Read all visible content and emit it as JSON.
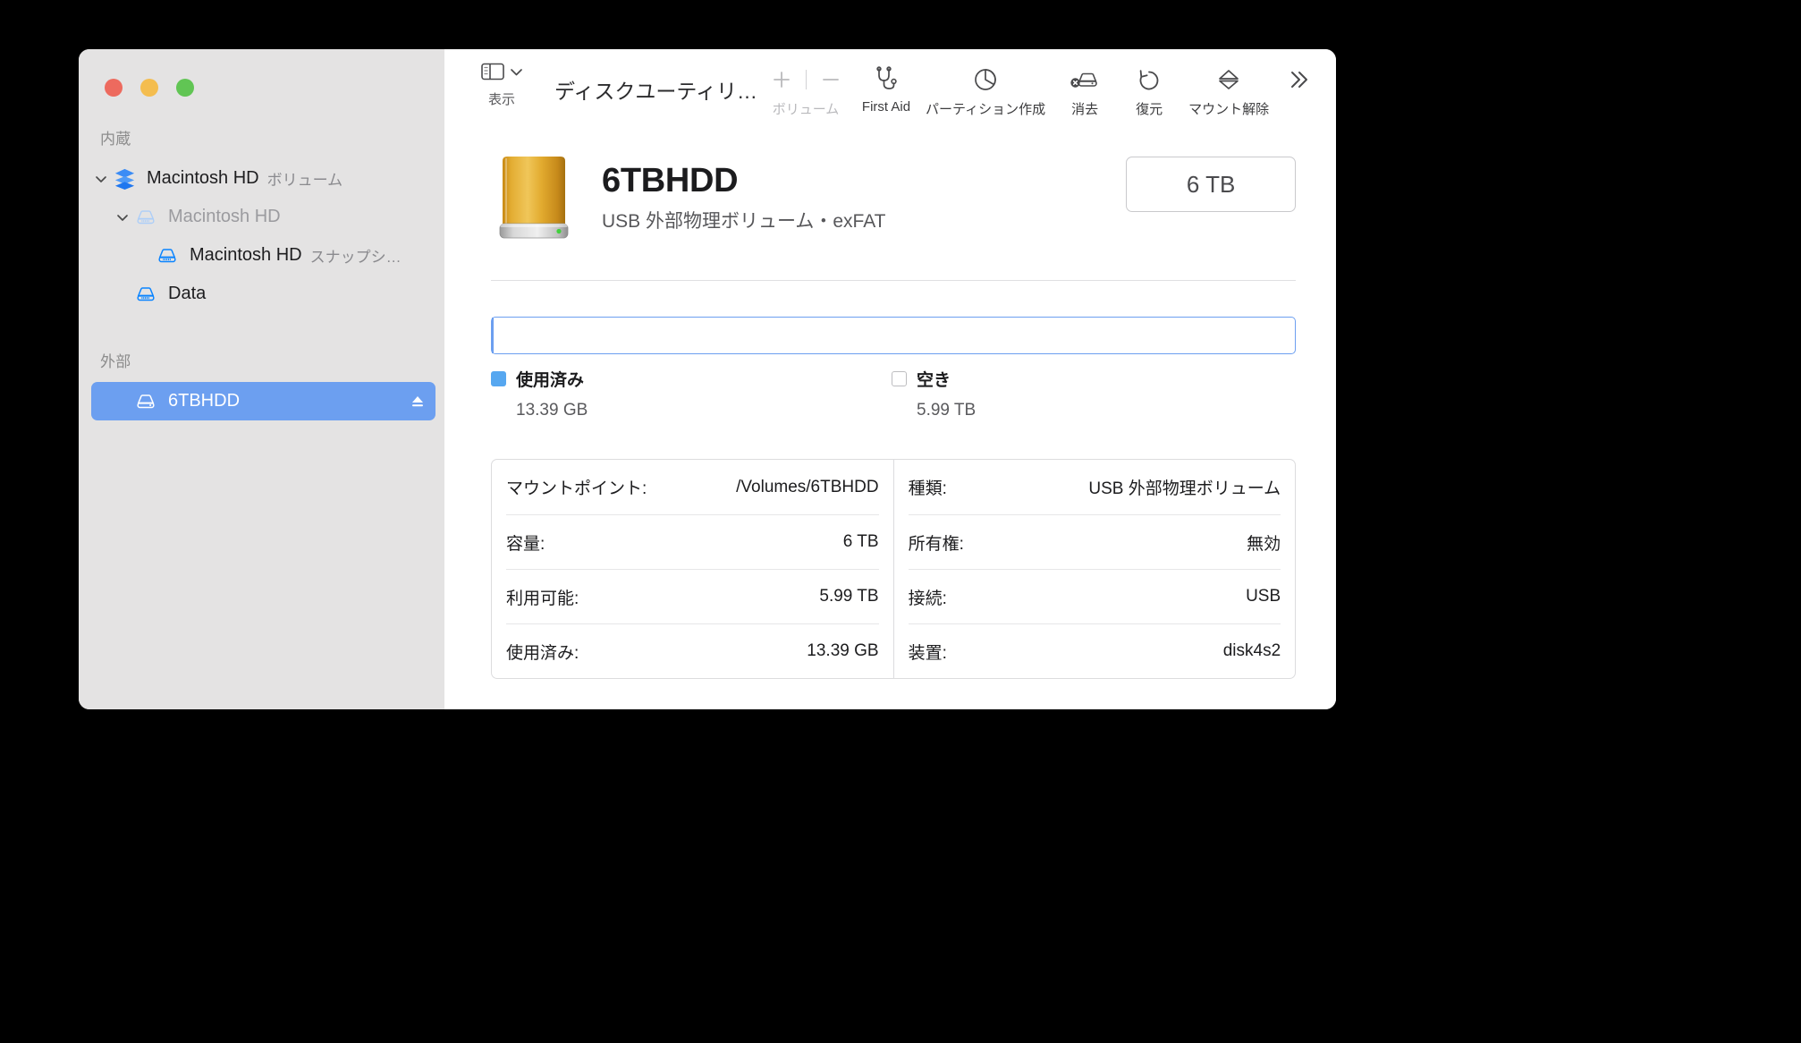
{
  "window": {
    "traffic_lights": [
      "close",
      "minimize",
      "zoom"
    ]
  },
  "toolbar": {
    "sidebar_toggle_caption": "表示",
    "title": "ディスクユーティリ…",
    "items": [
      {
        "label": "ボリューム",
        "icon": "plus-minus-icon",
        "disabled": true
      },
      {
        "label": "First Aid",
        "icon": "stethoscope-icon",
        "disabled": false
      },
      {
        "label": "パーティション作成",
        "icon": "pie-chart-icon",
        "disabled": false
      },
      {
        "label": "消去",
        "icon": "erase-disk-icon",
        "disabled": false
      },
      {
        "label": "復元",
        "icon": "restore-undo-icon",
        "disabled": false
      },
      {
        "label": "マウント解除",
        "icon": "eject-icon",
        "disabled": false
      }
    ],
    "overflow_label": "»"
  },
  "sidebar": {
    "sections": [
      {
        "header": "内蔵",
        "items": [
          {
            "label": "Macintosh HD",
            "sublabel": "ボリューム",
            "icon": "volume-group-icon",
            "indent": 0,
            "twisty": "expanded",
            "selected": false,
            "dim": false
          },
          {
            "label": "Macintosh HD",
            "sublabel": "",
            "icon": "disk-icon-light",
            "indent": 1,
            "twisty": "expanded",
            "selected": false,
            "dim": true
          },
          {
            "label": "Macintosh HD",
            "sublabel": "スナップシ…",
            "icon": "disk-icon",
            "indent": 2,
            "twisty": "none",
            "selected": false,
            "dim": false
          },
          {
            "label": "Data",
            "sublabel": "",
            "icon": "disk-icon",
            "indent": 3,
            "twisty": "none",
            "selected": false,
            "dim": false
          }
        ]
      },
      {
        "header": "外部",
        "items": [
          {
            "label": "6TBHDD",
            "sublabel": "",
            "icon": "disk-icon-white",
            "indent": 3,
            "twisty": "none",
            "selected": true,
            "dim": false,
            "eject": true
          }
        ]
      }
    ]
  },
  "disk": {
    "name": "6TBHDD",
    "subtitle": "USB 外部物理ボリューム・exFAT",
    "capacity_badge": "6 TB",
    "icon": "external-hdd-gold-icon"
  },
  "usage": {
    "used_percent": 0.22,
    "legend": [
      {
        "name": "使用済み",
        "value": "13.39 GB",
        "swatch": "used",
        "color": "#56a7f0"
      },
      {
        "name": "空き",
        "value": "5.99 TB",
        "swatch": "free",
        "color": "#ffffff"
      }
    ]
  },
  "info": {
    "left": [
      {
        "key": "マウントポイント:",
        "value": "/Volumes/6TBHDD"
      },
      {
        "key": "容量:",
        "value": "6 TB"
      },
      {
        "key": "利用可能:",
        "value": "5.99 TB"
      },
      {
        "key": "使用済み:",
        "value": "13.39 GB"
      }
    ],
    "right": [
      {
        "key": "種類:",
        "value": "USB 外部物理ボリューム"
      },
      {
        "key": "所有権:",
        "value": "無効"
      },
      {
        "key": "接続:",
        "value": "USB"
      },
      {
        "key": "装置:",
        "value": "disk4s2"
      }
    ]
  },
  "colors": {
    "accent": "#6c9ff0",
    "sidebar_bg": "#e4e3e3",
    "used_blue": "#56a7f0"
  }
}
